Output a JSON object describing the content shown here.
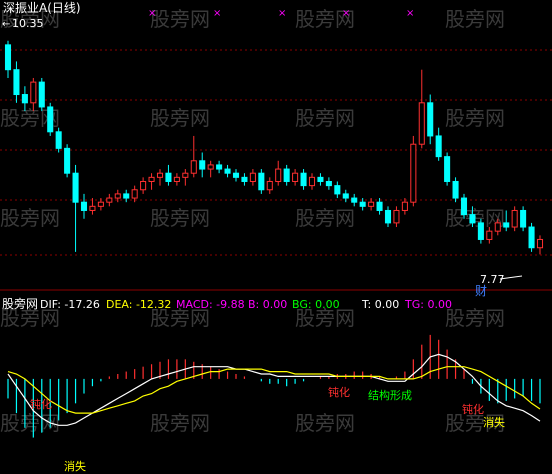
{
  "title": "深振业A(日线)",
  "watermark": "股旁网",
  "price_panel": {
    "high_label": "10.35",
    "low_label": "7.77",
    "cai_label": "财",
    "x_marks": [
      "×",
      "×",
      "×",
      "×",
      "×"
    ]
  },
  "indicator_bar": {
    "name": "股旁网",
    "items": [
      {
        "text": "DIF: -17.26",
        "color": "#ffffff"
      },
      {
        "text": "DEA: -12.32",
        "color": "#ffff00"
      },
      {
        "text": "MACD: -9.88",
        "color": "#ff00ff"
      },
      {
        "text": "B: 0.00",
        "color": "#ff00ff"
      },
      {
        "text": "BG: 0.00",
        "color": "#00ff00"
      },
      {
        "text": "T: 0.00",
        "color": "#ffffff"
      },
      {
        "text": "TG: 0.00",
        "color": "#ff00ff"
      }
    ]
  },
  "annotations": [
    {
      "text": "钝化",
      "color": "#ff3030"
    },
    {
      "text": "消失",
      "color": "#ffff00"
    },
    {
      "text": "钝化",
      "color": "#ff3030"
    },
    {
      "text": "结构形成",
      "color": "#00ff00"
    },
    {
      "text": "钝化",
      "color": "#ff3030"
    },
    {
      "text": "消失",
      "color": "#ffff00"
    }
  ],
  "colors": {
    "up": "#ff3030",
    "down": "#00ffff",
    "grid": "#8b0000",
    "dif": "#ffffff",
    "dea": "#ffff00"
  },
  "chart_data": {
    "type": "candlestick",
    "title": "深振业A(日线)",
    "price_ylim": [
      7.4,
      10.6
    ],
    "price_labels": [
      10.35,
      7.77
    ],
    "candles": [
      [
        10.3,
        10.35,
        9.9,
        10.0
      ],
      [
        10.0,
        10.1,
        9.6,
        9.7
      ],
      [
        9.7,
        9.8,
        9.5,
        9.6
      ],
      [
        9.6,
        9.9,
        9.5,
        9.85
      ],
      [
        9.85,
        9.9,
        9.5,
        9.55
      ],
      [
        9.55,
        9.6,
        9.2,
        9.25
      ],
      [
        9.25,
        9.3,
        9.0,
        9.05
      ],
      [
        9.05,
        9.1,
        8.7,
        8.75
      ],
      [
        8.75,
        8.85,
        7.8,
        8.4
      ],
      [
        8.4,
        8.5,
        8.2,
        8.3
      ],
      [
        8.3,
        8.45,
        8.25,
        8.35
      ],
      [
        8.35,
        8.45,
        8.3,
        8.4
      ],
      [
        8.4,
        8.5,
        8.35,
        8.45
      ],
      [
        8.45,
        8.55,
        8.4,
        8.5
      ],
      [
        8.5,
        8.55,
        8.4,
        8.45
      ],
      [
        8.45,
        8.6,
        8.4,
        8.55
      ],
      [
        8.55,
        8.7,
        8.5,
        8.65
      ],
      [
        8.65,
        8.75,
        8.55,
        8.7
      ],
      [
        8.7,
        8.8,
        8.6,
        8.75
      ],
      [
        8.75,
        8.85,
        8.6,
        8.65
      ],
      [
        8.65,
        8.75,
        8.6,
        8.7
      ],
      [
        8.7,
        8.8,
        8.6,
        8.75
      ],
      [
        8.75,
        9.2,
        8.7,
        8.9
      ],
      [
        8.9,
        9.0,
        8.7,
        8.8
      ],
      [
        8.8,
        8.9,
        8.7,
        8.85
      ],
      [
        8.85,
        8.9,
        8.75,
        8.8
      ],
      [
        8.8,
        8.85,
        8.7,
        8.75
      ],
      [
        8.75,
        8.8,
        8.65,
        8.7
      ],
      [
        8.7,
        8.75,
        8.6,
        8.65
      ],
      [
        8.65,
        8.8,
        8.6,
        8.75
      ],
      [
        8.75,
        8.8,
        8.5,
        8.55
      ],
      [
        8.55,
        8.7,
        8.5,
        8.65
      ],
      [
        8.65,
        8.9,
        8.6,
        8.8
      ],
      [
        8.8,
        8.85,
        8.6,
        8.65
      ],
      [
        8.65,
        8.8,
        8.6,
        8.75
      ],
      [
        8.75,
        8.8,
        8.55,
        8.6
      ],
      [
        8.6,
        8.75,
        8.55,
        8.7
      ],
      [
        8.7,
        8.75,
        8.6,
        8.65
      ],
      [
        8.65,
        8.7,
        8.55,
        8.6
      ],
      [
        8.6,
        8.65,
        8.45,
        8.5
      ],
      [
        8.5,
        8.55,
        8.4,
        8.45
      ],
      [
        8.45,
        8.5,
        8.35,
        8.4
      ],
      [
        8.4,
        8.45,
        8.3,
        8.35
      ],
      [
        8.35,
        8.45,
        8.3,
        8.4
      ],
      [
        8.4,
        8.45,
        8.25,
        8.3
      ],
      [
        8.3,
        8.35,
        8.1,
        8.15
      ],
      [
        8.15,
        8.35,
        8.1,
        8.3
      ],
      [
        8.3,
        8.45,
        8.25,
        8.4
      ],
      [
        8.4,
        9.2,
        8.35,
        9.1
      ],
      [
        9.1,
        10.0,
        9.05,
        9.6
      ],
      [
        9.6,
        9.7,
        9.1,
        9.2
      ],
      [
        9.2,
        9.3,
        8.9,
        8.95
      ],
      [
        8.95,
        9.0,
        8.6,
        8.65
      ],
      [
        8.65,
        8.7,
        8.4,
        8.45
      ],
      [
        8.45,
        8.5,
        8.2,
        8.25
      ],
      [
        8.25,
        8.35,
        8.1,
        8.15
      ],
      [
        8.15,
        8.2,
        7.9,
        7.95
      ],
      [
        7.95,
        8.1,
        7.9,
        8.05
      ],
      [
        8.05,
        8.2,
        8.0,
        8.15
      ],
      [
        8.15,
        8.3,
        8.05,
        8.1
      ],
      [
        8.1,
        8.35,
        8.05,
        8.3
      ],
      [
        8.3,
        8.35,
        8.05,
        8.1
      ],
      [
        8.1,
        8.15,
        7.8,
        7.85
      ],
      [
        7.85,
        8.0,
        7.77,
        7.95
      ]
    ],
    "macd_ylim": [
      -25,
      20
    ],
    "macd": [
      -8,
      -14,
      -20,
      -24,
      -22,
      -20,
      -17,
      -14,
      -10,
      -6,
      -3,
      -1,
      1,
      2,
      3,
      4,
      5,
      6,
      7,
      8,
      8,
      8,
      7,
      6,
      5,
      4,
      3,
      2,
      1,
      0,
      -1,
      -2,
      -2,
      -3,
      -2,
      -1,
      0,
      1,
      1,
      2,
      2,
      3,
      3,
      2,
      1,
      0,
      1,
      3,
      8,
      14,
      18,
      16,
      12,
      8,
      4,
      -2,
      -6,
      -9,
      -10,
      -9,
      -8,
      -7,
      -9,
      -10
    ],
    "dif": [
      2,
      -3,
      -8,
      -13,
      -16,
      -18,
      -19,
      -19,
      -18,
      -16,
      -14,
      -12,
      -10,
      -8,
      -6,
      -4,
      -2,
      0,
      1,
      2,
      3,
      4,
      5,
      5,
      5,
      5,
      5,
      4,
      4,
      3,
      2,
      2,
      1,
      1,
      1,
      1,
      1,
      1,
      1,
      1,
      1,
      1,
      1,
      1,
      0,
      -1,
      -1,
      -1,
      2,
      5,
      9,
      10,
      9,
      7,
      4,
      1,
      -3,
      -6,
      -9,
      -11,
      -12,
      -13,
      -15,
      -17.26
    ],
    "dea": [
      3,
      2,
      0,
      -3,
      -6,
      -9,
      -11,
      -13,
      -14,
      -14,
      -14,
      -13,
      -12,
      -11,
      -10,
      -9,
      -7,
      -6,
      -4,
      -3,
      -1,
      0,
      1,
      2,
      3,
      3,
      4,
      4,
      4,
      4,
      4,
      3,
      3,
      3,
      2,
      2,
      2,
      2,
      2,
      1,
      1,
      1,
      1,
      1,
      1,
      0,
      0,
      0,
      0,
      1,
      3,
      4,
      5,
      5,
      5,
      4,
      3,
      1,
      -1,
      -3,
      -5,
      -7,
      -10,
      -12.32
    ]
  }
}
